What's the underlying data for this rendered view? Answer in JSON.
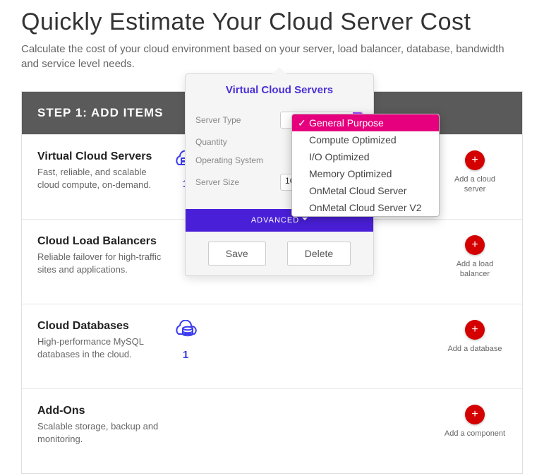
{
  "page": {
    "title": "Quickly Estimate Your Cloud Server Cost",
    "subtitle": "Calculate the cost of your cloud environment based on your server, load balancer, database, bandwidth and service level needs.",
    "step_header": "STEP 1: ADD ITEMS"
  },
  "items": [
    {
      "title": "Virtual Cloud Servers",
      "desc": "Fast, reliable, and scalable cloud compute, on-demand.",
      "icon": "server-icon",
      "count": "1",
      "add_label": "Add a cloud server"
    },
    {
      "title": "Cloud Load Balancers",
      "desc": "Reliable failover for high-traffic sites and applications.",
      "icon": "",
      "count": "",
      "add_label": "Add a load balancer"
    },
    {
      "title": "Cloud Databases",
      "desc": "High-performance MySQL databases in the cloud.",
      "icon": "database-icon",
      "count": "1",
      "add_label": "Add a database"
    },
    {
      "title": "Add-Ons",
      "desc": "Scalable storage, backup and monitoring.",
      "icon": "",
      "count": "",
      "add_label": "Add a component"
    }
  ],
  "popover": {
    "title": "Virtual Cloud Servers",
    "fields": {
      "server_type_label": "Server Type",
      "quantity_label": "Quantity",
      "os_label": "Operating System",
      "size_label": "Server Size",
      "size_value": "1GB"
    },
    "advanced": "ADVANCED",
    "save": "Save",
    "delete": "Delete"
  },
  "server_type_options": [
    "General Purpose",
    "Compute Optimized",
    "I/O Optimized",
    "Memory Optimized",
    "OnMetal Cloud Server",
    "OnMetal Cloud Server V2"
  ],
  "add_plus": "+"
}
